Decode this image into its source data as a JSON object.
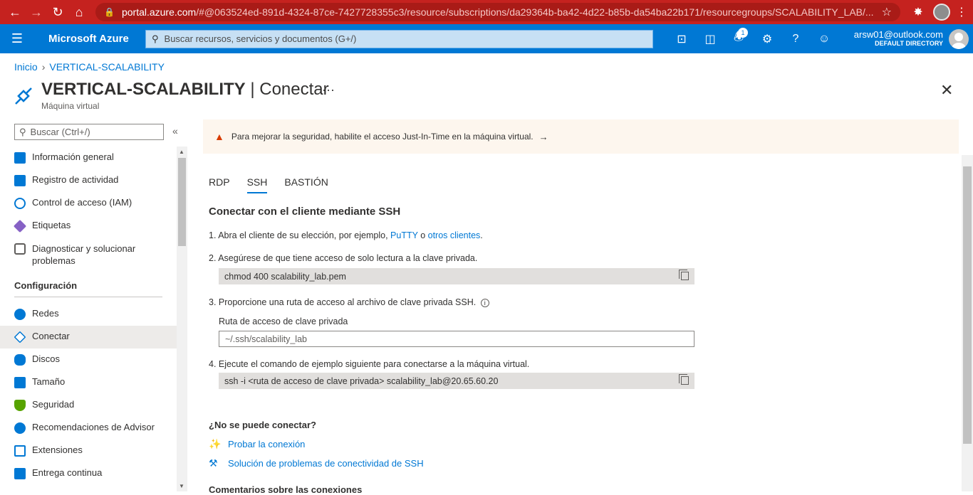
{
  "browser": {
    "url_host": "portal.azure.com",
    "url_path": "/#@063524ed-891d-4324-87ce-7427728355c3/resource/subscriptions/da29364b-ba42-4d22-b85b-da54ba22b171/resourcegroups/SCALABILITY_LAB/..."
  },
  "azure": {
    "brand": "Microsoft Azure",
    "search_placeholder": "Buscar recursos, servicios y documentos (G+/)",
    "notification_count": "1",
    "account_email": "arsw01@outlook.com",
    "account_directory": "DEFAULT DIRECTORY"
  },
  "breadcrumb": {
    "home": "Inicio",
    "current": "VERTICAL-SCALABILITY"
  },
  "header": {
    "resource_name": "VERTICAL-SCALABILITY",
    "separator": "|",
    "blade": "Conectar",
    "subtitle": "Máquina virtual",
    "more": "···",
    "close": "✕"
  },
  "sidebar": {
    "search_placeholder": "Buscar (Ctrl+/)",
    "collapse": "«",
    "items_top": [
      {
        "label": "Información general",
        "color": "#0078d4"
      },
      {
        "label": "Registro de actividad",
        "color": "#0078d4"
      },
      {
        "label": "Control de acceso (IAM)",
        "color": "#0078d4"
      },
      {
        "label": "Etiquetas",
        "color": "#8661c5"
      },
      {
        "label": "Diagnosticar y solucionar problemas",
        "color": "#605e5c"
      }
    ],
    "section": "Configuración",
    "items_config": [
      {
        "label": "Redes",
        "color": "#0078d4"
      },
      {
        "label": "Conectar",
        "color": "#0078d4"
      },
      {
        "label": "Discos",
        "color": "#0078d4"
      },
      {
        "label": "Tamaño",
        "color": "#0078d4"
      },
      {
        "label": "Seguridad",
        "color": "#57a300"
      },
      {
        "label": "Recomendaciones de Advisor",
        "color": "#0078d4"
      },
      {
        "label": "Extensiones",
        "color": "#0078d4"
      },
      {
        "label": "Entrega continua",
        "color": "#0078d4"
      }
    ]
  },
  "banner": {
    "text": "Para mejorar la seguridad, habilite el acceso Just-In-Time en la máquina virtual.",
    "arrow": "→"
  },
  "tabs": [
    "RDP",
    "SSH",
    "BASTIÓN"
  ],
  "content": {
    "heading": "Conectar con el cliente mediante SSH",
    "step1_prefix": "1. Abra el cliente de su elección, por ejemplo,",
    "step1_link1": "PuTTY",
    "step1_mid": "o",
    "step1_link2": "otros clientes",
    "step1_suffix": ".",
    "step2": "2. Asegúrese de que tiene acceso de solo lectura a la clave privada.",
    "step2_code": "chmod 400 scalability_lab.pem",
    "step3": "3. Proporcione una ruta de acceso al archivo de clave privada SSH.",
    "field_label": "Ruta de acceso de clave privada",
    "field_value": "~/.ssh/scalability_lab",
    "step4": "4. Ejecute el comando de ejemplo siguiente para conectarse a la máquina virtual.",
    "step4_code": "ssh -i <ruta de acceso de clave privada> scalability_lab@20.65.60.20",
    "help_heading": "¿No se puede conectar?",
    "link_test": "Probar la conexión",
    "link_troubleshoot": "Solución de problemas de conectividad de SSH",
    "comments_heading": "Comentarios sobre las conexiones"
  }
}
